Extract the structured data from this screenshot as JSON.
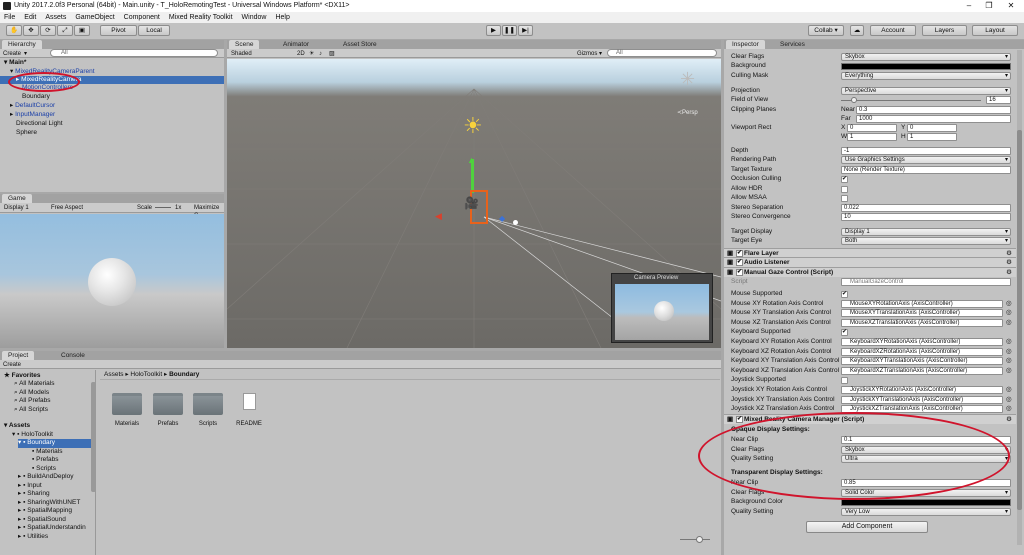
{
  "window": {
    "title": "Unity 2017.2.0f3 Personal (64bit) - Main.unity - T_HoloRemotingTest - Universal Windows Platform* <DX11>"
  },
  "menu": [
    "File",
    "Edit",
    "Assets",
    "GameObject",
    "Component",
    "Mixed Reality Toolkit",
    "Window",
    "Help"
  ],
  "toolbar": {
    "pivot": "Pivot",
    "local": "Local",
    "collab": "Collab ▾",
    "account": "Account",
    "layers": "Layers",
    "layout": "Layout"
  },
  "hierarchy": {
    "tab": "Hierarchy",
    "create": "Create",
    "search": "All",
    "scene": "Main*",
    "items": [
      "MixedRealityCameraParent",
      "MixedRealityCamera",
      "MotionControllers",
      "Boundary",
      "DefaultCursor",
      "InputManager",
      "Directional Light",
      "Sphere"
    ]
  },
  "scene": {
    "tabs": [
      "Scene",
      "Animator",
      "Asset Store"
    ],
    "shaded": "Shaded",
    "mode2d": "2D",
    "gizmos": "Gizmos ▾",
    "search": "All",
    "persp": "≺Persp",
    "preview_title": "Camera Preview"
  },
  "game": {
    "tab": "Game",
    "display": "Display 1",
    "aspect": "Free Aspect",
    "scale_label": "Scale",
    "scale_value": "1x",
    "maximize": "Maximize C"
  },
  "project": {
    "tabs": [
      "Project",
      "Console"
    ],
    "create": "Create",
    "breadcrumb": [
      "Assets",
      "HoloToolkit",
      "Boundary"
    ],
    "favorites_label": "Favorites",
    "favorites": [
      "All Materials",
      "All Models",
      "All Prefabs",
      "All Scripts"
    ],
    "assets_label": "Assets",
    "tree": [
      "HoloToolkit",
      "Boundary",
      "Materials",
      "Prefabs",
      "Scripts",
      "BuildAndDeploy",
      "Input",
      "Sharing",
      "SharingWithUNET",
      "SpatialMapping",
      "SpatialSound",
      "SpatialUnderstandin",
      "Utilities"
    ],
    "items": [
      "Materials",
      "Prefabs",
      "Scripts",
      "README"
    ]
  },
  "inspector": {
    "tabs": [
      "Inspector",
      "Services"
    ],
    "camera_rows": [
      {
        "label": "Clear Flags",
        "value": "Skybox",
        "kind": "drop"
      },
      {
        "label": "Background",
        "value": "",
        "kind": "color"
      },
      {
        "label": "Culling Mask",
        "value": "Everything",
        "kind": "drop"
      },
      {
        "label": "Projection",
        "value": "Perspective",
        "kind": "drop"
      },
      {
        "label": "Field of View",
        "value": "16",
        "kind": "slider"
      },
      {
        "label": "Clipping Planes",
        "value": "",
        "kind": "none"
      },
      {
        "label": "Depth",
        "value": "-1",
        "kind": "field"
      },
      {
        "label": "Rendering Path",
        "value": "Use Graphics Settings",
        "kind": "drop"
      },
      {
        "label": "Target Texture",
        "value": "None (Render Texture)",
        "kind": "field"
      },
      {
        "label": "Occlusion Culling",
        "value": "✔",
        "kind": "check"
      },
      {
        "label": "Allow HDR",
        "value": "",
        "kind": "check"
      },
      {
        "label": "Allow MSAA",
        "value": "",
        "kind": "check"
      },
      {
        "label": "Stereo Separation",
        "value": "0.022",
        "kind": "field"
      },
      {
        "label": "Stereo Convergence",
        "value": "10",
        "kind": "field"
      },
      {
        "label": "Target Display",
        "value": "Display 1",
        "kind": "drop"
      },
      {
        "label": "Target Eye",
        "value": "Both",
        "kind": "drop"
      }
    ],
    "near_label": "Near",
    "near": "0.3",
    "far_label": "Far",
    "far": "1000",
    "viewport_label": "Viewport Rect",
    "vx": "0",
    "vy": "0",
    "vw": "1",
    "vh": "1",
    "flare": "Flare Layer",
    "audio": "Audio Listener",
    "gaze": {
      "title": "Manual Gaze Control (Script)",
      "script_label": "Script",
      "script": "ManualGazeControl",
      "rows": [
        {
          "label": "Mouse Supported",
          "value": "✔",
          "kind": "check"
        },
        {
          "label": "Mouse XY Rotation Axis Control",
          "value": "MouseXYRotationAxis (AxisController)",
          "kind": "obj"
        },
        {
          "label": "Mouse XY Translation Axis Control",
          "value": "MouseXYTranslationAxis (AxisController)",
          "kind": "obj"
        },
        {
          "label": "Mouse XZ Translation Axis Control",
          "value": "MouseXZTranslationAxis (AxisController)",
          "kind": "obj"
        },
        {
          "label": "Keyboard Supported",
          "value": "✔",
          "kind": "check"
        },
        {
          "label": "Keyboard XY Rotation Axis Control",
          "value": "KeyboardXYRotationAxis (AxisController)",
          "kind": "obj"
        },
        {
          "label": "Keyboard XZ Rotation Axis Control",
          "value": "KeyboardXZRotationAxis (AxisController)",
          "kind": "obj"
        },
        {
          "label": "Keyboard XY Translation Axis Control",
          "value": "KeyboardXYTranslationAxis (AxisController)",
          "kind": "obj"
        },
        {
          "label": "Keyboard XZ Translation Axis Control",
          "value": "KeyboardXZTranslationAxis (AxisController)",
          "kind": "obj"
        },
        {
          "label": "Joystick Supported",
          "value": "",
          "kind": "check"
        },
        {
          "label": "Joystick XY Rotation Axis Control",
          "value": "JoystickXYRotationAxis (AxisController)",
          "kind": "obj"
        },
        {
          "label": "Joystick XY Translation Axis Control",
          "value": "JoystickXYTranslationAxis (AxisController)",
          "kind": "obj"
        },
        {
          "label": "Joystick XZ Translation Axis Control",
          "value": "JoystickXZTranslationAxis (AxisController)",
          "kind": "obj"
        }
      ]
    },
    "mrcm": {
      "title": "Mixed Reality Camera Manager (Script)",
      "opaque_header": "Opaque Display Settings:",
      "opaque": [
        {
          "label": "Near Clip",
          "value": "0.1",
          "kind": "field"
        },
        {
          "label": "Clear Flags",
          "value": "Skybox",
          "kind": "drop"
        },
        {
          "label": "Quality Setting",
          "value": "Ultra",
          "kind": "drop"
        }
      ],
      "trans_header": "Transparent Display Settings:",
      "trans": [
        {
          "label": "Near Clip",
          "value": "0.85",
          "kind": "field"
        },
        {
          "label": "Clear Flags",
          "value": "Solid Color",
          "kind": "drop"
        },
        {
          "label": "Background Color",
          "value": "",
          "kind": "color"
        },
        {
          "label": "Quality Setting",
          "value": "Very Low",
          "kind": "drop"
        }
      ]
    },
    "add_component": "Add Component"
  }
}
